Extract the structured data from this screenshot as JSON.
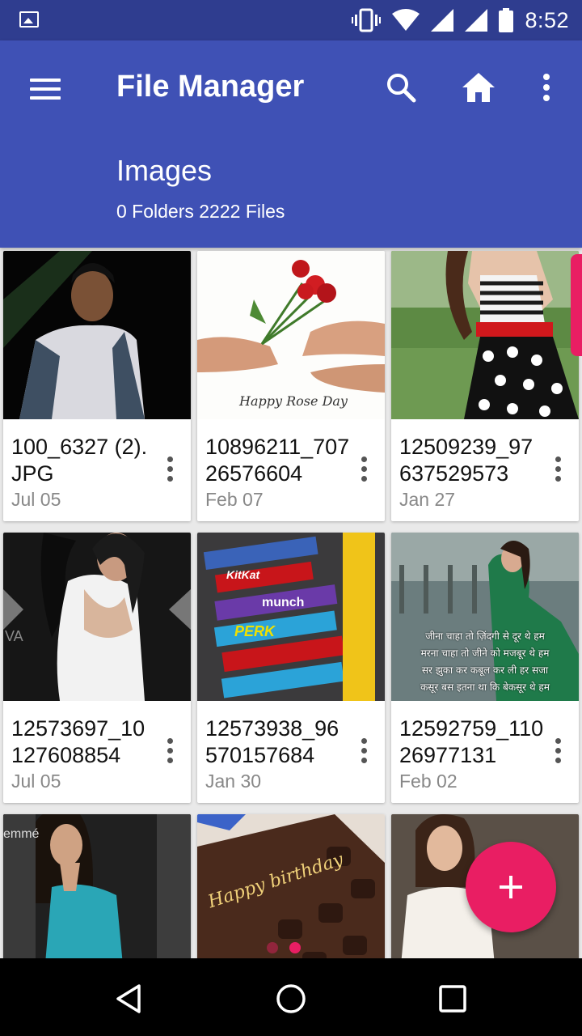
{
  "status_bar": {
    "time": "8:52",
    "icons": [
      "gallery-icon",
      "vibrate-icon",
      "wifi-icon",
      "signal-icon",
      "signal-icon",
      "battery-icon"
    ]
  },
  "app_bar": {
    "title": "File Manager",
    "section_title": "Images",
    "section_subtitle": "0 Folders 2222 Files",
    "icons": [
      "menu-icon",
      "search-icon",
      "home-icon",
      "more-vert-icon"
    ]
  },
  "files": [
    {
      "name": "100_6327 (2).JPG",
      "date": "Jul 05"
    },
    {
      "name": "10896211_70726576604",
      "date": "Feb 07"
    },
    {
      "name": "12509239_97637529573",
      "date": "Jan 27"
    },
    {
      "name": "12573697_10127608854",
      "date": "Jul 05"
    },
    {
      "name": "12573938_96570157684",
      "date": "Jan 30"
    },
    {
      "name": "12592759_11026977131",
      "date": "Feb 02"
    }
  ],
  "thumb_text": {
    "rose_caption": "Happy Rose Day",
    "choc_labels": [
      "KitKat",
      "munch",
      "PERK"
    ],
    "poem_lines": [
      "जीना चाहा तो ज़िंदगी से दूर थे हम",
      "मरना चाहा तो जीने को मजबूर थे हम",
      "सर झुका कर कबूल कर ली हर सजा",
      "कसूर बस इतना था कि बेकसूर थे हम"
    ],
    "birthday_text": "Happy birthday",
    "brand_text": "emmé"
  },
  "colors": {
    "primary": "#3f51b5",
    "status_bar": "#2f3d8f",
    "accent": "#e91e63"
  }
}
